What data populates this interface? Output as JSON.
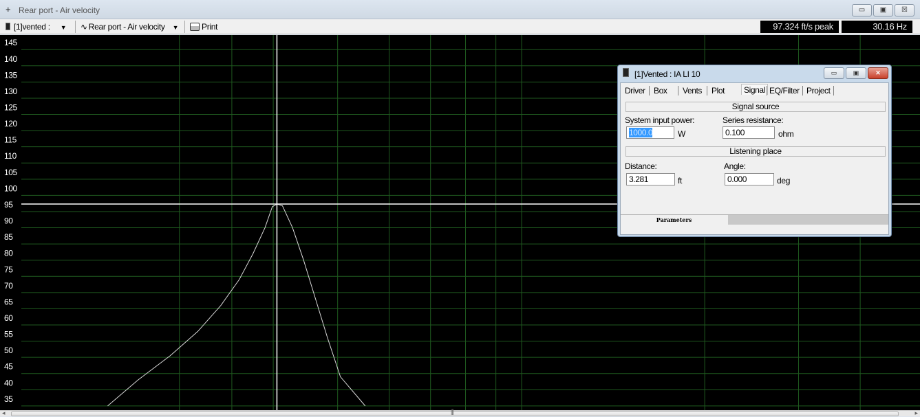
{
  "window": {
    "title": "Rear port - Air velocity",
    "app_icon": "+",
    "minimize": "▭",
    "maximize": "▣",
    "close": "☒"
  },
  "toolbar": {
    "project_select": "[1]vented :",
    "curve_select": "Rear port - Air velocity",
    "print_label": "Print",
    "peak_readout": "97.324 ft/s peak",
    "freq_readout": "30.16 Hz"
  },
  "chart_data": {
    "type": "line",
    "y_tick_labels": [
      "35",
      "40",
      "45",
      "50",
      "55",
      "60",
      "65",
      "70",
      "75",
      "80",
      "85",
      "90",
      "95",
      "100",
      "105",
      "110",
      "115",
      "120",
      "125",
      "130",
      "135",
      "140",
      "145"
    ],
    "ylim": [
      33.7,
      149.5
    ],
    "grid": true,
    "background": "#000000",
    "grid_color": "#1f5a1f",
    "curve_color": "#d8d8d8",
    "cursor": {
      "peak_value": 97.324,
      "frequency_hz": 30.16
    },
    "series": [
      {
        "points_frac_y": [
          [
            0.117,
            35.0
          ],
          [
            0.15,
            43.0
          ],
          [
            0.185,
            50.5
          ],
          [
            0.215,
            58.0
          ],
          [
            0.24,
            66.0
          ],
          [
            0.26,
            74.0
          ],
          [
            0.275,
            82.0
          ],
          [
            0.288,
            90.0
          ],
          [
            0.296,
            96.5
          ],
          [
            0.301,
            97.32
          ],
          [
            0.307,
            96.8
          ],
          [
            0.318,
            90.0
          ],
          [
            0.33,
            80.0
          ],
          [
            0.343,
            68.0
          ],
          [
            0.356,
            56.0
          ],
          [
            0.37,
            44.0
          ],
          [
            0.397,
            35.0
          ]
        ]
      }
    ]
  },
  "dialog": {
    "title": "[1]Vented : IA LI 10",
    "tabs": [
      "Driver",
      "Box",
      "Vents",
      "Plot",
      "Signal",
      "EQ/Filter",
      "Project"
    ],
    "active_tab": "Signal",
    "signal_source_header": "Signal source",
    "system_input_power_label": "System input power:",
    "system_input_power_value": "1000.0",
    "power_unit": "W",
    "series_resistance_label": "Series resistance:",
    "series_resistance_value": "0.100",
    "resistance_unit": "ohm",
    "listening_place_header": "Listening place",
    "distance_label": "Distance:",
    "distance_value": "3.281",
    "distance_unit": "ft",
    "angle_label": "Angle:",
    "angle_value": "0.000",
    "angle_unit": "deg",
    "footer_tab": "Parameters"
  },
  "scrollbar": {
    "grip": "|||",
    "left_arrow": "◂",
    "right_arrow": "▸"
  }
}
